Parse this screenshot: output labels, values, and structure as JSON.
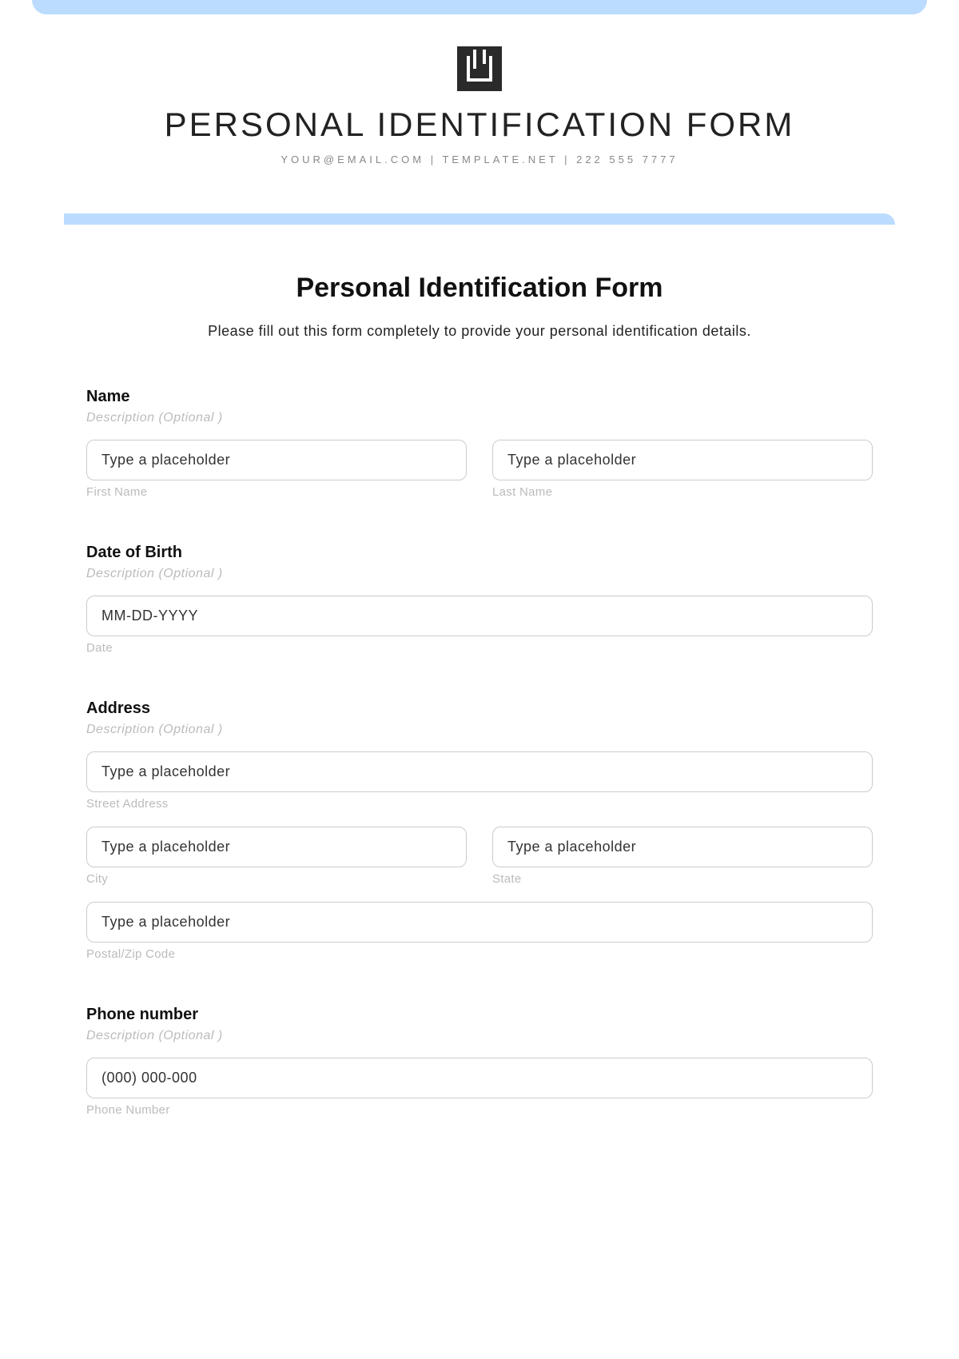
{
  "header": {
    "title": "PERSONAL IDENTIFICATION FORM",
    "subtitle": "YOUR@EMAIL.COM | TEMPLATE.NET | 222 555 7777"
  },
  "form": {
    "title": "Personal Identification Form",
    "intro": "Please fill out this form completely to provide your personal identification details."
  },
  "sections": {
    "name": {
      "label": "Name",
      "desc": "Description (Optional )",
      "first_placeholder": "Type a placeholder",
      "first_sublabel": "First Name",
      "last_placeholder": "Type a placeholder",
      "last_sublabel": "Last Name"
    },
    "dob": {
      "label": "Date of Birth",
      "desc": "Description (Optional )",
      "placeholder": "MM-DD-YYYY",
      "sublabel": "Date"
    },
    "address": {
      "label": "Address",
      "desc": "Description (Optional )",
      "street_placeholder": "Type a placeholder",
      "street_sublabel": "Street Address",
      "city_placeholder": "Type a placeholder",
      "city_sublabel": "City",
      "state_placeholder": "Type a placeholder",
      "state_sublabel": "State",
      "zip_placeholder": "Type a placeholder",
      "zip_sublabel": "Postal/Zip Code"
    },
    "phone": {
      "label": "Phone number",
      "desc": "Description (Optional )",
      "placeholder": "(000) 000-000",
      "sublabel": "Phone Number"
    }
  }
}
